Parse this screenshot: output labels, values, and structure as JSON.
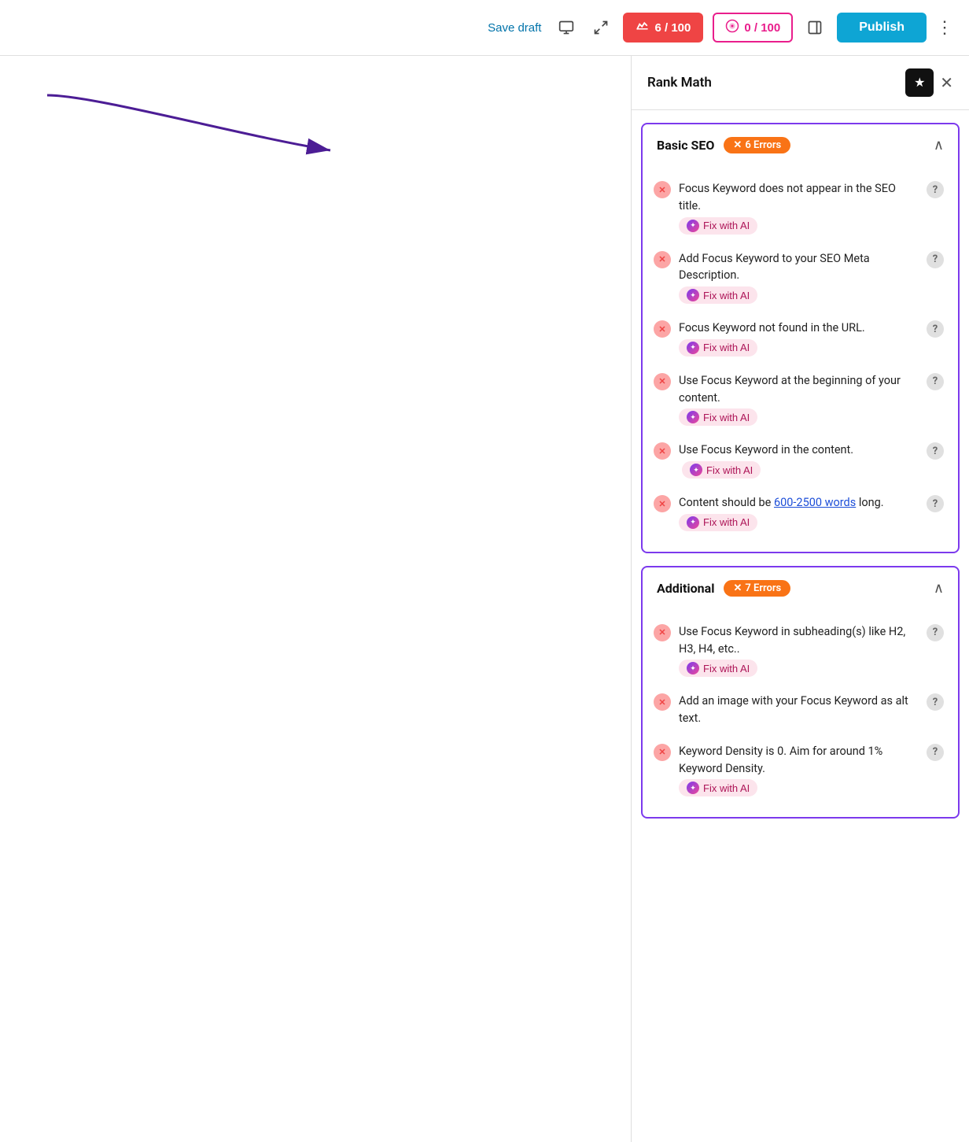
{
  "toolbar": {
    "save_draft_label": "Save draft",
    "score1": {
      "value": "6 / 100",
      "type": "red"
    },
    "score2": {
      "value": "0 / 100",
      "type": "pink"
    },
    "publish_label": "Publish"
  },
  "panel": {
    "title": "Rank Math",
    "sections": [
      {
        "id": "basic-seo",
        "title": "Basic SEO",
        "errors_label": "6 Errors",
        "items": [
          {
            "text": "Focus Keyword does not appear in the SEO title.",
            "has_fix": true,
            "has_link": false
          },
          {
            "text": "Add Focus Keyword to your SEO Meta Description.",
            "has_fix": true,
            "has_link": false
          },
          {
            "text": "Focus Keyword not found in the URL.",
            "has_fix": true,
            "has_link": false
          },
          {
            "text": "Use Focus Keyword at the beginning of your content.",
            "has_fix": true,
            "has_link": false
          },
          {
            "text": "Use Focus Keyword in the content.",
            "has_fix": true,
            "has_link": false
          },
          {
            "text": "Content should be",
            "link_text": "600-2500 words",
            "text_after": "long.",
            "has_fix": true,
            "has_link": true
          }
        ]
      },
      {
        "id": "additional",
        "title": "Additional",
        "errors_label": "7 Errors",
        "items": [
          {
            "text": "Use Focus Keyword in subheading(s) like H2, H3, H4, etc..",
            "has_fix": true,
            "has_link": false
          },
          {
            "text": "Add an image with your Focus Keyword as alt text.",
            "has_fix": false,
            "has_link": false
          },
          {
            "text": "Keyword Density is 0. Aim for around 1% Keyword Density.",
            "has_fix": true,
            "has_link": false
          }
        ]
      }
    ],
    "fix_ai_label": "Fix with AI"
  }
}
